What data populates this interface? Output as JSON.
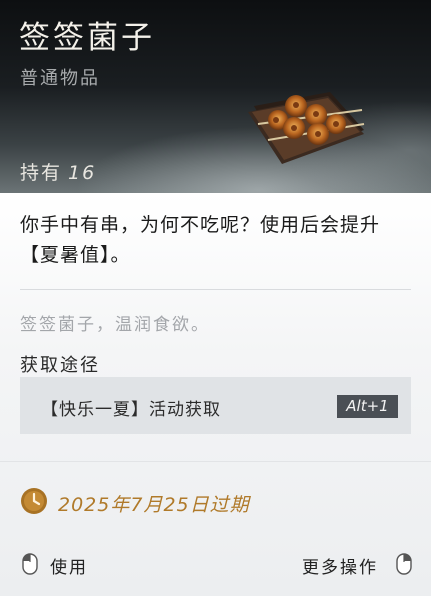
{
  "item": {
    "name": "签签菌子",
    "category": "普通物品",
    "owned_label": "持有",
    "owned_count": "16",
    "image_icon": "skewered-mushroom-plate-icon"
  },
  "description": "你手中有串，为何不吃呢？使用后会提升【夏暑值】。",
  "flavor_text": "签签菌子，温润食欲。",
  "acquisition": {
    "title": "获取途径",
    "sources": [
      {
        "text": "【快乐一夏】活动获取",
        "hotkey": "Alt+1"
      }
    ]
  },
  "expiry": {
    "icon": "clock-icon",
    "text": "2025年7月25日过期",
    "color": "#b07a2a"
  },
  "footer": {
    "use_label": "使用",
    "use_icon": "left-mouse-icon",
    "more_label": "更多操作",
    "more_icon": "right-mouse-icon"
  }
}
